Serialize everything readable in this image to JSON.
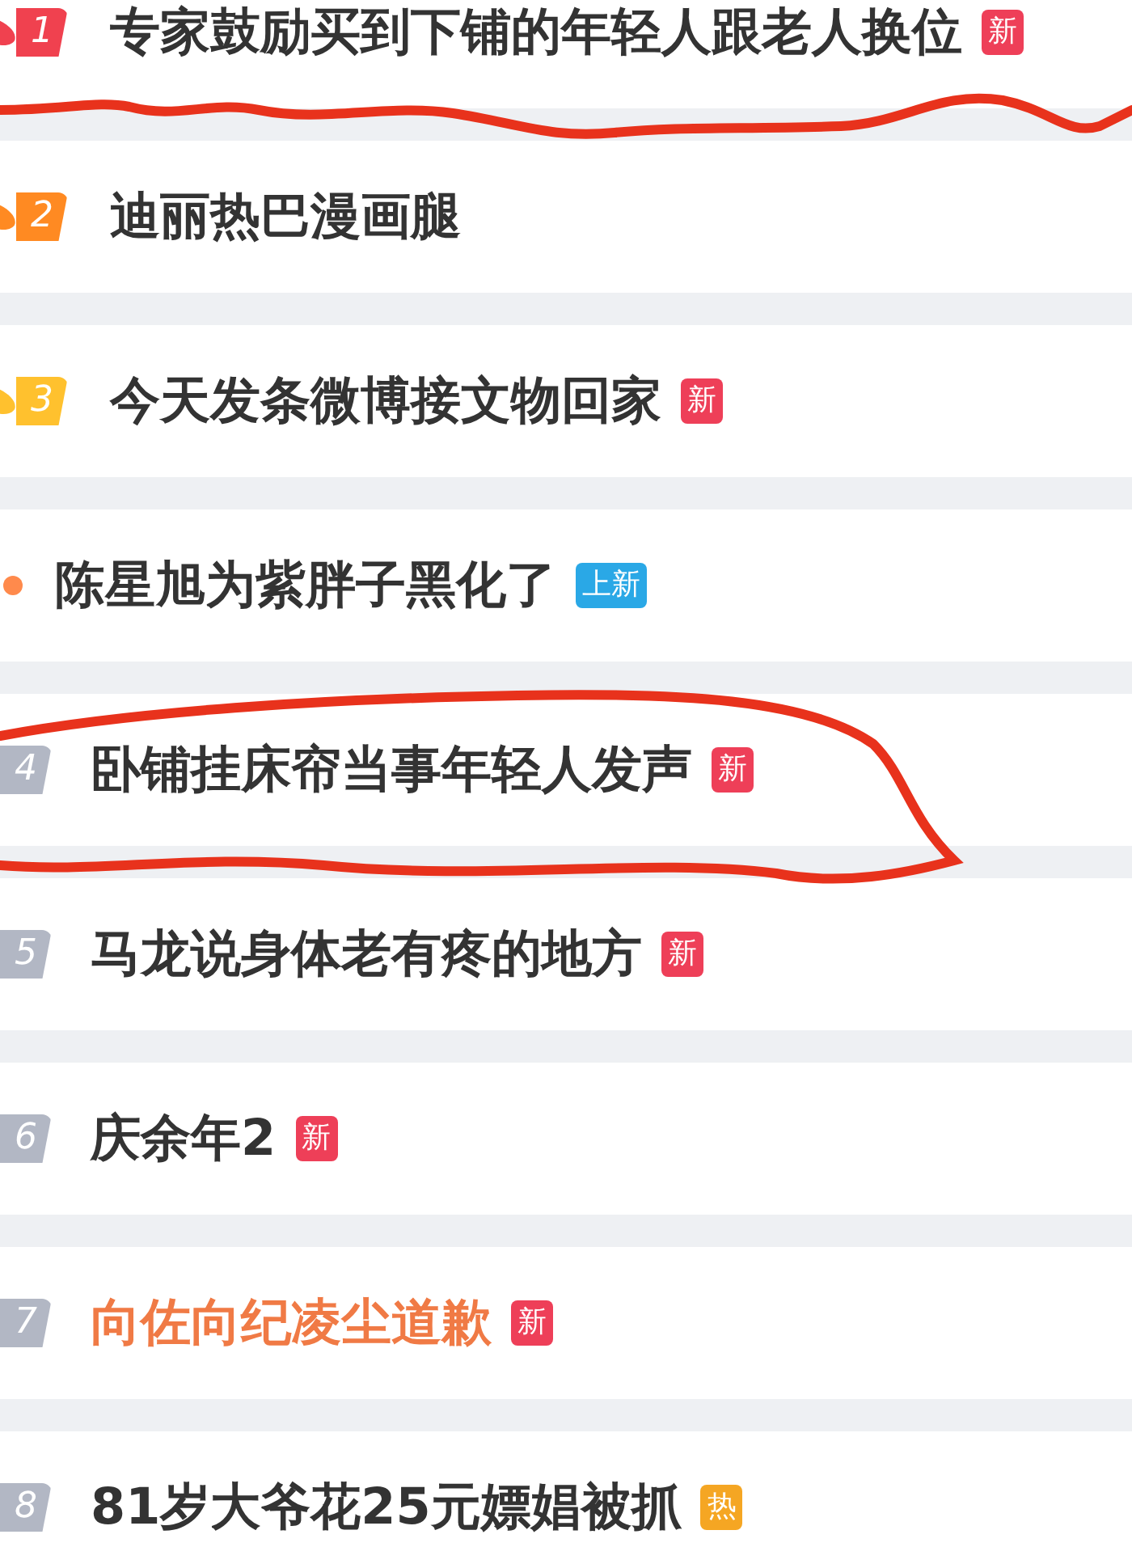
{
  "hot_list": [
    {
      "kind": "ranked",
      "rank": "1",
      "color": "#f0414f",
      "flame": true,
      "title": "专家鼓励买到下铺的年轻人跟老人换位",
      "highlighted": false,
      "tag": {
        "kind": "new",
        "text": "新"
      }
    },
    {
      "kind": "ranked",
      "rank": "2",
      "color": "#ff8a22",
      "flame": true,
      "title": "迪丽热巴漫画腿",
      "highlighted": false
    },
    {
      "kind": "ranked",
      "rank": "3",
      "color": "#ffc12e",
      "flame": true,
      "title": "今天发条微博接文物回家",
      "highlighted": false,
      "tag": {
        "kind": "new",
        "text": "新"
      }
    },
    {
      "kind": "pinned",
      "color": "#ff8a4c",
      "flame": false,
      "title": "陈星旭为紫胖子黑化了",
      "highlighted": false,
      "tag": {
        "kind": "up-new",
        "text": "上新"
      }
    },
    {
      "kind": "ranked",
      "rank": "4",
      "color": "#b2b7c4",
      "flame": false,
      "title": "卧铺挂床帘当事年轻人发声",
      "highlighted": false,
      "tag": {
        "kind": "new",
        "text": "新"
      }
    },
    {
      "kind": "ranked",
      "rank": "5",
      "color": "#b2b7c4",
      "flame": false,
      "title": "马龙说身体老有疼的地方",
      "highlighted": false,
      "tag": {
        "kind": "new",
        "text": "新"
      }
    },
    {
      "kind": "ranked",
      "rank": "6",
      "color": "#b2b7c4",
      "flame": false,
      "title": "庆余年2",
      "highlighted": false,
      "tag": {
        "kind": "new",
        "text": "新"
      }
    },
    {
      "kind": "ranked",
      "rank": "7",
      "color": "#b2b7c4",
      "flame": false,
      "title": "向佐向纪凌尘道歉",
      "highlighted": true,
      "tag": {
        "kind": "new",
        "text": "新"
      }
    },
    {
      "kind": "ranked",
      "rank": "8",
      "color": "#b2b7c4",
      "flame": false,
      "title": "81岁大爷花25元嫖娼被抓",
      "highlighted": false,
      "tag": {
        "kind": "hot",
        "text": "热"
      }
    }
  ]
}
